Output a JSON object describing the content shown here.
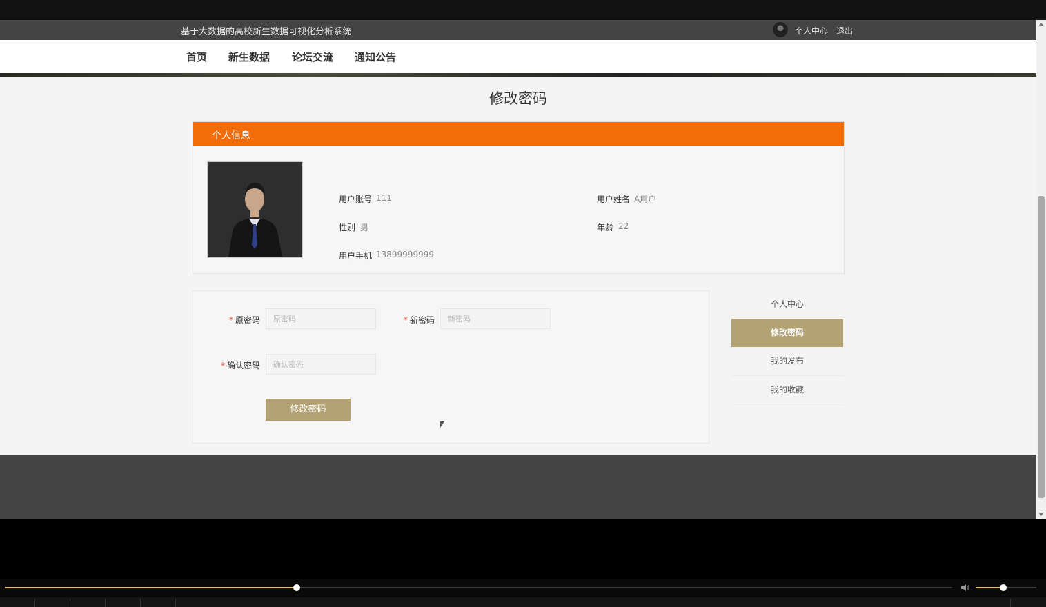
{
  "header": {
    "site_title": "基于大数据的高校新生数据可视化分析系统",
    "user_center": "个人中心",
    "logout": "退出"
  },
  "nav": {
    "items": [
      {
        "label": "首页"
      },
      {
        "label": "新生数据"
      },
      {
        "label": "论坛交流"
      },
      {
        "label": "通知公告"
      }
    ]
  },
  "page": {
    "heading": "修改密码"
  },
  "profile": {
    "section_title": "个人信息",
    "account_label": "用户账号",
    "account_value": "111",
    "name_label": "用户姓名",
    "name_value": "A用户",
    "gender_label": "性别",
    "gender_value": "男",
    "age_label": "年龄",
    "age_value": "22",
    "phone_label": "用户手机",
    "phone_value": "13899999999"
  },
  "form": {
    "old_password_label": "原密码",
    "old_password_placeholder": "原密码",
    "new_password_label": "新密码",
    "new_password_placeholder": "新密码",
    "confirm_password_label": "确认密码",
    "confirm_password_placeholder": "确认密码",
    "required_mark": "*",
    "submit_label": "修改密码"
  },
  "side_menu": {
    "items": [
      {
        "label": "个人中心",
        "active": false
      },
      {
        "label": "修改密码",
        "active": true
      },
      {
        "label": "我的发布",
        "active": false
      },
      {
        "label": "我的收藏",
        "active": false
      }
    ]
  },
  "player": {
    "progress": 0.308,
    "volume": 0.45
  },
  "colors": {
    "accent_orange": "#f26d07",
    "accent_gold": "#b3a274",
    "header_bg": "#444444",
    "progress_yellow": "#f2c81a"
  }
}
